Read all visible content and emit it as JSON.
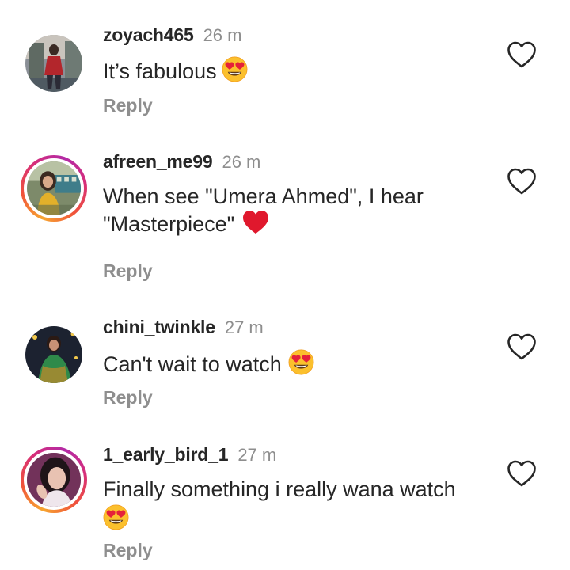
{
  "comments": [
    {
      "username": "zoyach465",
      "time": "26 m",
      "text": "It’s fabulous",
      "emoji": "heart-eyes-emoji",
      "reply_label": "Reply",
      "story_ring": false
    },
    {
      "username": "afreen_me99",
      "time": "26 m",
      "text_line1": "When see \"Umera Ahmed\", I hear",
      "text_line2": "\"Masterpiece\"",
      "emoji": "red-heart-emoji",
      "reply_label": "Reply",
      "story_ring": true
    },
    {
      "username": "chini_twinkle",
      "time": "27 m",
      "text": "Can't wait to watch",
      "emoji": "heart-eyes-emoji",
      "reply_label": "Reply",
      "story_ring": false
    },
    {
      "username": "1_early_bird_1",
      "time": "27 m",
      "text": "Finally something i really wana watch",
      "emoji": "heart-eyes-emoji",
      "reply_label": "Reply",
      "story_ring": true
    }
  ],
  "icons": {
    "like": "heart-outline-icon"
  },
  "colors": {
    "text": "#262626",
    "muted": "#8e8e8e",
    "heart_red": "#e0182d",
    "emoji_yellow": "#fbc02d",
    "story_ring_start": "#f7a631",
    "story_ring_end": "#b32aa6"
  }
}
